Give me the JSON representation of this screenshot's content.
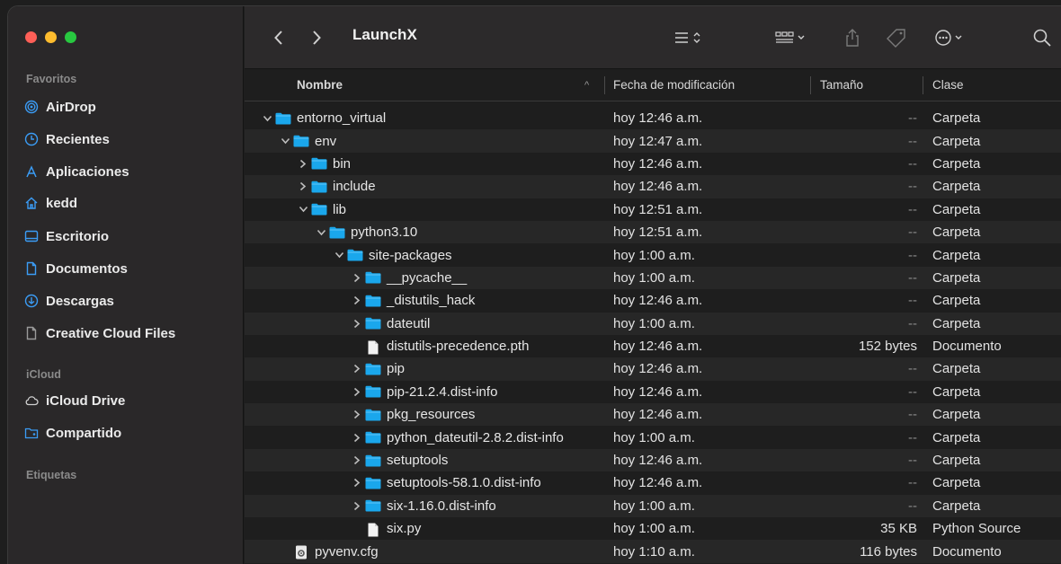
{
  "window": {
    "title": "LaunchX"
  },
  "sidebar": {
    "sections": {
      "favorites": "Favoritos",
      "icloud": "iCloud",
      "tags": "Etiquetas"
    },
    "favorites": [
      {
        "label": "AirDrop",
        "icon": "airdrop-icon"
      },
      {
        "label": "Recientes",
        "icon": "clock-icon"
      },
      {
        "label": "Aplicaciones",
        "icon": "apps-icon"
      },
      {
        "label": "kedd",
        "icon": "home-icon"
      },
      {
        "label": "Escritorio",
        "icon": "desktop-icon"
      },
      {
        "label": "Documentos",
        "icon": "document-icon"
      },
      {
        "label": "Descargas",
        "icon": "download-icon"
      },
      {
        "label": "Creative Cloud Files",
        "icon": "file-icon"
      }
    ],
    "icloud": [
      {
        "label": "iCloud Drive",
        "icon": "cloud-icon"
      },
      {
        "label": "Compartido",
        "icon": "shared-folder-icon"
      }
    ]
  },
  "columns": {
    "name": "Nombre",
    "date": "Fecha de modificación",
    "size": "Tamaño",
    "kind": "Clase"
  },
  "rows": [
    {
      "name": "entorno_virtual",
      "date": "hoy 12:46 a.m.",
      "size": "--",
      "kind": "Carpeta",
      "level": 0,
      "type": "folder",
      "chevron": "open"
    },
    {
      "name": "env",
      "date": "hoy 12:47 a.m.",
      "size": "--",
      "kind": "Carpeta",
      "level": 1,
      "type": "folder",
      "chevron": "open"
    },
    {
      "name": "bin",
      "date": "hoy 12:46 a.m.",
      "size": "--",
      "kind": "Carpeta",
      "level": 2,
      "type": "folder",
      "chevron": "closed"
    },
    {
      "name": "include",
      "date": "hoy 12:46 a.m.",
      "size": "--",
      "kind": "Carpeta",
      "level": 2,
      "type": "folder",
      "chevron": "closed"
    },
    {
      "name": "lib",
      "date": "hoy 12:51 a.m.",
      "size": "--",
      "kind": "Carpeta",
      "level": 2,
      "type": "folder",
      "chevron": "open"
    },
    {
      "name": "python3.10",
      "date": "hoy 12:51 a.m.",
      "size": "--",
      "kind": "Carpeta",
      "level": 3,
      "type": "folder",
      "chevron": "open"
    },
    {
      "name": "site-packages",
      "date": "hoy 1:00 a.m.",
      "size": "--",
      "kind": "Carpeta",
      "level": 4,
      "type": "folder",
      "chevron": "open"
    },
    {
      "name": "__pycache__",
      "date": "hoy 1:00 a.m.",
      "size": "--",
      "kind": "Carpeta",
      "level": 5,
      "type": "folder",
      "chevron": "closed"
    },
    {
      "name": "_distutils_hack",
      "date": "hoy 12:46 a.m.",
      "size": "--",
      "kind": "Carpeta",
      "level": 5,
      "type": "folder",
      "chevron": "closed"
    },
    {
      "name": "dateutil",
      "date": "hoy 1:00 a.m.",
      "size": "--",
      "kind": "Carpeta",
      "level": 5,
      "type": "folder",
      "chevron": "closed"
    },
    {
      "name": "distutils-precedence.pth",
      "date": "hoy 12:46 a.m.",
      "size": "152 bytes",
      "kind": "Documento",
      "level": 5,
      "type": "file",
      "chevron": "none"
    },
    {
      "name": "pip",
      "date": "hoy 12:46 a.m.",
      "size": "--",
      "kind": "Carpeta",
      "level": 5,
      "type": "folder",
      "chevron": "closed"
    },
    {
      "name": "pip-21.2.4.dist-info",
      "date": "hoy 12:46 a.m.",
      "size": "--",
      "kind": "Carpeta",
      "level": 5,
      "type": "folder",
      "chevron": "closed"
    },
    {
      "name": "pkg_resources",
      "date": "hoy 12:46 a.m.",
      "size": "--",
      "kind": "Carpeta",
      "level": 5,
      "type": "folder",
      "chevron": "closed"
    },
    {
      "name": "python_dateutil-2.8.2.dist-info",
      "date": "hoy 1:00 a.m.",
      "size": "--",
      "kind": "Carpeta",
      "level": 5,
      "type": "folder",
      "chevron": "closed"
    },
    {
      "name": "setuptools",
      "date": "hoy 12:46 a.m.",
      "size": "--",
      "kind": "Carpeta",
      "level": 5,
      "type": "folder",
      "chevron": "closed"
    },
    {
      "name": "setuptools-58.1.0.dist-info",
      "date": "hoy 12:46 a.m.",
      "size": "--",
      "kind": "Carpeta",
      "level": 5,
      "type": "folder",
      "chevron": "closed"
    },
    {
      "name": "six-1.16.0.dist-info",
      "date": "hoy 1:00 a.m.",
      "size": "--",
      "kind": "Carpeta",
      "level": 5,
      "type": "folder",
      "chevron": "closed"
    },
    {
      "name": "six.py",
      "date": "hoy 1:00 a.m.",
      "size": "35 KB",
      "kind": "Python Source",
      "level": 5,
      "type": "file",
      "chevron": "none"
    },
    {
      "name": "pyvenv.cfg",
      "date": "hoy 1:10 a.m.",
      "size": "116 bytes",
      "kind": "Documento",
      "level": 1,
      "type": "cfg",
      "chevron": "none"
    }
  ],
  "colors": {
    "folder": "#1aa7ec",
    "accent_blue": "#3b9cf5"
  }
}
